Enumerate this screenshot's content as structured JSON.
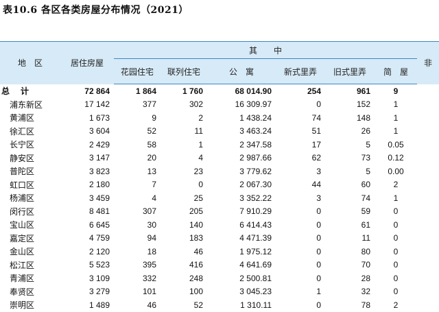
{
  "title": "表10.6  各区各类房屋分布情况（2021）",
  "headers": {
    "region": "地　区",
    "residential": "居住房屋",
    "group": "其　　中",
    "garden": "花园住宅",
    "row_house": "联列住宅",
    "apartment": "公　寓",
    "new_lane": "新式里弄",
    "old_lane": "旧式里弄",
    "simple": "简　屋",
    "non_residential": "非"
  },
  "rows": [
    {
      "name": "总　计",
      "total": "72 864",
      "garden": "1 864",
      "row_house": "1 760",
      "apartment": "68 014.90",
      "new_lane": "254",
      "old_lane": "961",
      "simple": "9"
    },
    {
      "name": "浦东新区",
      "total": "17 142",
      "garden": "377",
      "row_house": "302",
      "apartment": "16 309.97",
      "new_lane": "0",
      "old_lane": "152",
      "simple": "1"
    },
    {
      "name": "黄浦区",
      "total": "1 673",
      "garden": "9",
      "row_house": "2",
      "apartment": "1 438.24",
      "new_lane": "74",
      "old_lane": "148",
      "simple": "1"
    },
    {
      "name": "徐汇区",
      "total": "3 604",
      "garden": "52",
      "row_house": "11",
      "apartment": "3 463.24",
      "new_lane": "51",
      "old_lane": "26",
      "simple": "1"
    },
    {
      "name": "长宁区",
      "total": "2 429",
      "garden": "58",
      "row_house": "1",
      "apartment": "2 347.58",
      "new_lane": "17",
      "old_lane": "5",
      "simple": "0.05"
    },
    {
      "name": "静安区",
      "total": "3 147",
      "garden": "20",
      "row_house": "4",
      "apartment": "2 987.66",
      "new_lane": "62",
      "old_lane": "73",
      "simple": "0.12"
    },
    {
      "name": "普陀区",
      "total": "3 823",
      "garden": "13",
      "row_house": "23",
      "apartment": "3 779.62",
      "new_lane": "3",
      "old_lane": "5",
      "simple": "0.00"
    },
    {
      "name": "虹口区",
      "total": "2 180",
      "garden": "7",
      "row_house": "0",
      "apartment": "2 067.30",
      "new_lane": "44",
      "old_lane": "60",
      "simple": "2"
    },
    {
      "name": "杨浦区",
      "total": "3 459",
      "garden": "4",
      "row_house": "25",
      "apartment": "3 352.22",
      "new_lane": "3",
      "old_lane": "74",
      "simple": "1"
    },
    {
      "name": "闵行区",
      "total": "8 481",
      "garden": "307",
      "row_house": "205",
      "apartment": "7 910.29",
      "new_lane": "0",
      "old_lane": "59",
      "simple": "0"
    },
    {
      "name": "宝山区",
      "total": "6 645",
      "garden": "30",
      "row_house": "140",
      "apartment": "6 414.43",
      "new_lane": "0",
      "old_lane": "61",
      "simple": "0"
    },
    {
      "name": "嘉定区",
      "total": "4 759",
      "garden": "94",
      "row_house": "183",
      "apartment": "4 471.39",
      "new_lane": "0",
      "old_lane": "11",
      "simple": "0"
    },
    {
      "name": "金山区",
      "total": "2 120",
      "garden": "18",
      "row_house": "46",
      "apartment": "1 975.12",
      "new_lane": "0",
      "old_lane": "80",
      "simple": "0"
    },
    {
      "name": "松江区",
      "total": "5 523",
      "garden": "395",
      "row_house": "416",
      "apartment": "4 641.69",
      "new_lane": "0",
      "old_lane": "70",
      "simple": "0"
    },
    {
      "name": "青浦区",
      "total": "3 109",
      "garden": "332",
      "row_house": "248",
      "apartment": "2 500.81",
      "new_lane": "0",
      "old_lane": "28",
      "simple": "0"
    },
    {
      "name": "奉贤区",
      "total": "3 279",
      "garden": "101",
      "row_house": "100",
      "apartment": "3 045.23",
      "new_lane": "1",
      "old_lane": "32",
      "simple": "0"
    },
    {
      "name": "崇明区",
      "total": "1 489",
      "garden": "46",
      "row_house": "52",
      "apartment": "1 310.11",
      "new_lane": "0",
      "old_lane": "78",
      "simple": "2"
    }
  ]
}
